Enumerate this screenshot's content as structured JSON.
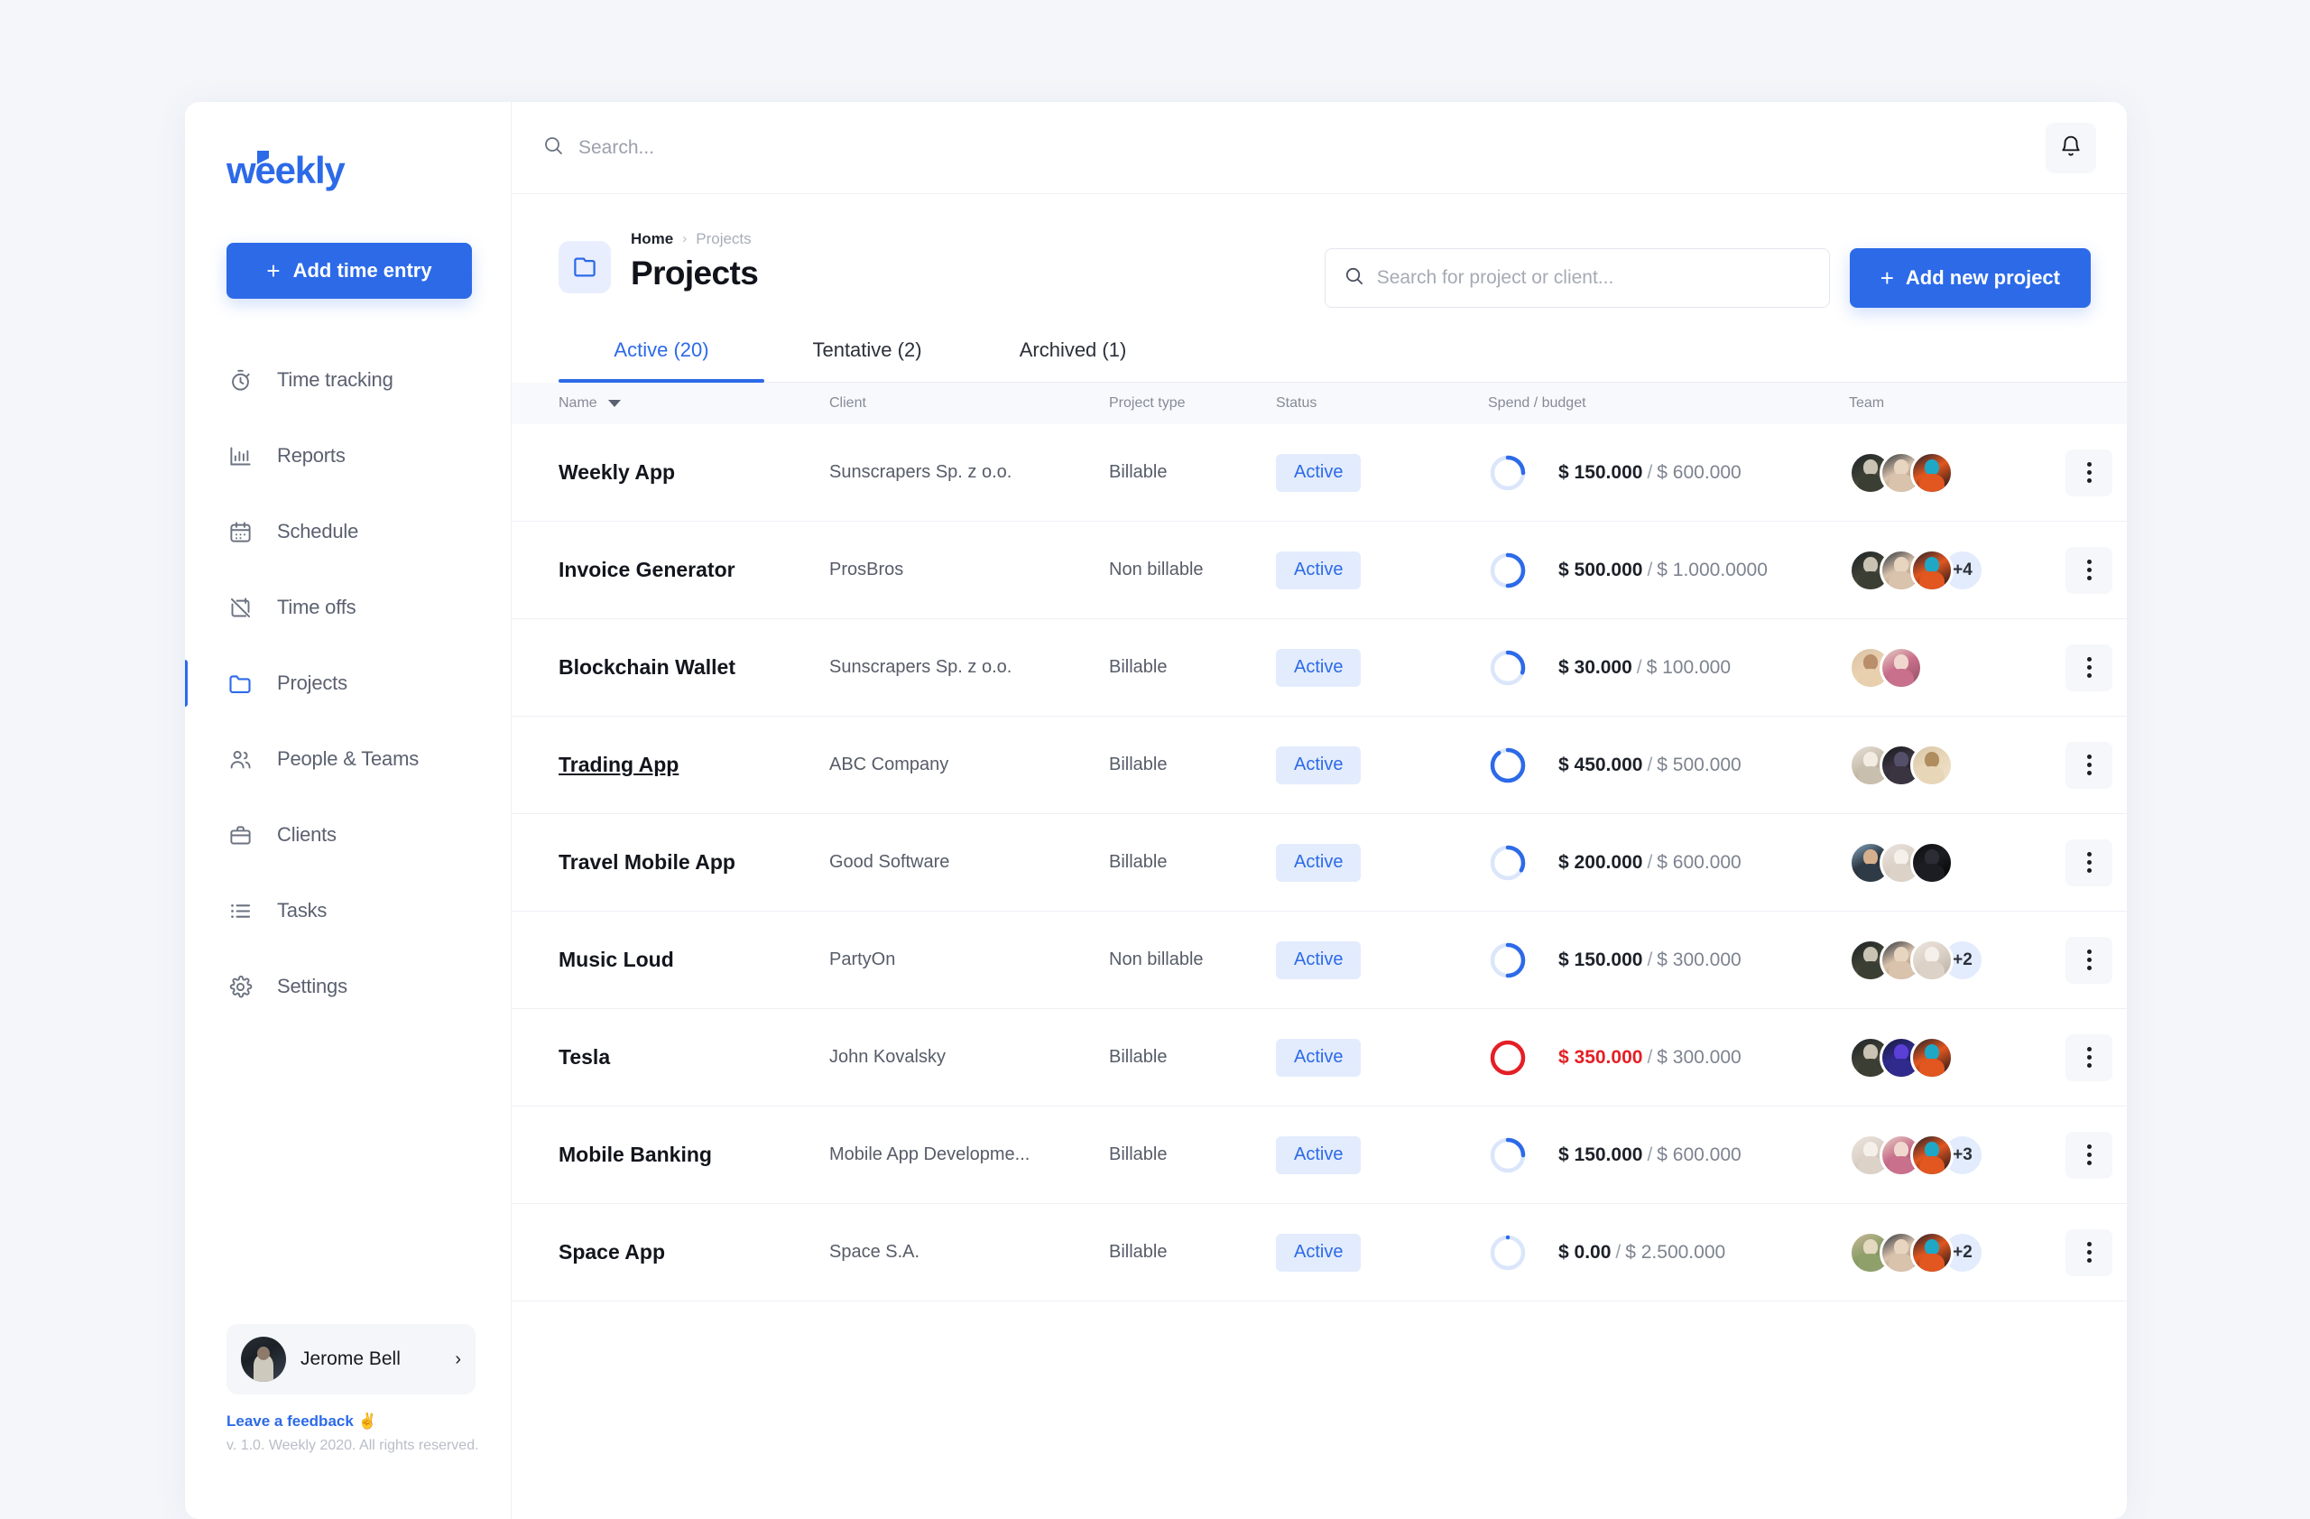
{
  "brand": {
    "name": "weekly"
  },
  "sidebar": {
    "add_entry_label": "Add time entry",
    "plus": "+",
    "items": [
      {
        "label": "Time tracking",
        "icon": "stopwatch-icon",
        "active": false
      },
      {
        "label": "Reports",
        "icon": "bar-chart-icon",
        "active": false
      },
      {
        "label": "Schedule",
        "icon": "calendar-icon",
        "active": false
      },
      {
        "label": "Time offs",
        "icon": "calendar-off-icon",
        "active": false
      },
      {
        "label": "Projects",
        "icon": "folder-icon",
        "active": true
      },
      {
        "label": "People & Teams",
        "icon": "people-icon",
        "active": false
      },
      {
        "label": "Clients",
        "icon": "briefcase-icon",
        "active": false
      },
      {
        "label": "Tasks",
        "icon": "list-icon",
        "active": false
      },
      {
        "label": "Settings",
        "icon": "gear-icon",
        "active": false
      }
    ],
    "user": {
      "name": "Jerome Bell",
      "chevron": "›"
    },
    "feedback": "Leave a feedback ✌",
    "copyright": "v. 1.0. Weekly 2020. All rights reserved."
  },
  "topbar": {
    "search_placeholder": "Search...",
    "search_value": "",
    "notifications_icon": "bell-icon"
  },
  "header": {
    "breadcrumb": {
      "home": "Home",
      "separator": "›",
      "current": "Projects"
    },
    "title": "Projects",
    "folder_icon": "folder-icon",
    "search_placeholder": "Search for project or client...",
    "search_value": "",
    "add_project_label": "Add new project",
    "plus": "+"
  },
  "tabs": [
    {
      "label": "Active (20)",
      "selected": true
    },
    {
      "label": "Tentative (2)",
      "selected": false
    },
    {
      "label": "Archived (1)",
      "selected": false
    }
  ],
  "table": {
    "columns": [
      "Name",
      "Client",
      "Project type",
      "Status",
      "Spend / budget",
      "Team"
    ],
    "sort_column": "Name",
    "sort_direction": "desc",
    "rows": [
      {
        "name": "Weekly App",
        "client": "Sunscrapers Sp. z o.o.",
        "type": "Billable",
        "status": "Active",
        "spent": "$ 150.000",
        "budget": "$ 600.000",
        "percent": 25,
        "over": false,
        "avatars": [
          "a1",
          "a2",
          "a3"
        ],
        "more": ""
      },
      {
        "name": "Invoice Generator",
        "client": "ProsBros",
        "type": "Non billable",
        "status": "Active",
        "spent": "$ 500.000",
        "budget": "$ 1.000.0000",
        "percent": 50,
        "over": false,
        "avatars": [
          "a1",
          "a2",
          "a3"
        ],
        "more": "+4"
      },
      {
        "name": "Blockchain Wallet",
        "client": "Sunscrapers Sp. z o.o.",
        "type": "Billable",
        "status": "Active",
        "spent": "$ 30.000",
        "budget": "$ 100.000",
        "percent": 30,
        "over": false,
        "avatars": [
          "a4",
          "a5"
        ],
        "more": ""
      },
      {
        "name": "Trading App",
        "client": "ABC Company",
        "type": "Billable",
        "status": "Active",
        "spent": "$ 450.000",
        "budget": "$ 500.000",
        "percent": 90,
        "over": false,
        "avatars": [
          "a6",
          "a7",
          "a8"
        ],
        "more": ""
      },
      {
        "name": "Travel Mobile App",
        "client": "Good Software",
        "type": "Billable",
        "status": "Active",
        "spent": "$ 200.000",
        "budget": "$ 600.000",
        "percent": 33,
        "over": false,
        "avatars": [
          "a9",
          "a10",
          "a11"
        ],
        "more": ""
      },
      {
        "name": "Music Loud",
        "client": "PartyOn",
        "type": "Non billable",
        "status": "Active",
        "spent": "$ 150.000",
        "budget": "$ 300.000",
        "percent": 50,
        "over": false,
        "avatars": [
          "a1",
          "a2",
          "a10"
        ],
        "more": "+2"
      },
      {
        "name": "Tesla",
        "client": "John Kovalsky",
        "type": "Billable",
        "status": "Active",
        "spent": "$ 350.000",
        "budget": "$ 300.000",
        "percent": 100,
        "over": true,
        "avatars": [
          "a1",
          "a12",
          "a3"
        ],
        "more": ""
      },
      {
        "name": "Mobile Banking",
        "client": "Mobile App Developme...",
        "type": "Billable",
        "status": "Active",
        "spent": "$ 150.000",
        "budget": "$ 600.000",
        "percent": 25,
        "over": false,
        "avatars": [
          "a10",
          "a5",
          "a3"
        ],
        "more": "+3"
      },
      {
        "name": "Space App",
        "client": "Space S.A.",
        "type": "Billable",
        "status": "Active",
        "spent": "$ 0.00",
        "budget": "$ 2.500.000",
        "percent": 0,
        "over": false,
        "avatars": [
          "a13",
          "a2",
          "a3"
        ],
        "more": "+2"
      }
    ],
    "row_hover": "Trading App"
  },
  "colors": {
    "accent": "#2c6ae8",
    "over_budget": "#e41f25",
    "page_bg": "#f4f6fa",
    "badge_bg": "#e3ecfd"
  }
}
